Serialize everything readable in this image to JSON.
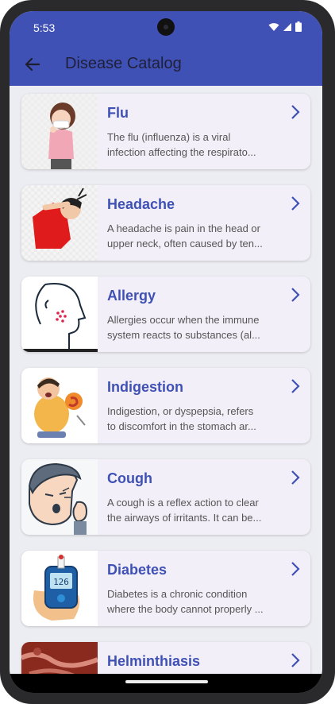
{
  "status": {
    "time": "5:53"
  },
  "appbar": {
    "title": "Disease Catalog"
  },
  "diseases": [
    {
      "name": "Flu",
      "line1": "The flu (influenza) is a viral",
      "line2": "infection affecting the respirato..."
    },
    {
      "name": "Headache",
      "line1": "A headache is pain in the head or",
      "line2": "upper neck, often caused by ten..."
    },
    {
      "name": "Allergy",
      "line1": "Allergies occur when the immune",
      "line2": "system reacts to substances (al..."
    },
    {
      "name": "Indigestion",
      "line1": "Indigestion, or dyspepsia, refers",
      "line2": "to discomfort in the stomach ar..."
    },
    {
      "name": "Cough",
      "line1": "A cough is a reflex action to clear",
      "line2": "the airways of irritants. It can be..."
    },
    {
      "name": "Diabetes",
      "line1": "Diabetes is a chronic condition",
      "line2": "where the body cannot properly ..."
    },
    {
      "name": "Helminthiasis",
      "line1": "",
      "line2": ""
    }
  ],
  "glucometer_reading": "126",
  "colors": {
    "primary": "#3f51b5",
    "card": "#f3eff8",
    "background": "#ecedf2"
  }
}
